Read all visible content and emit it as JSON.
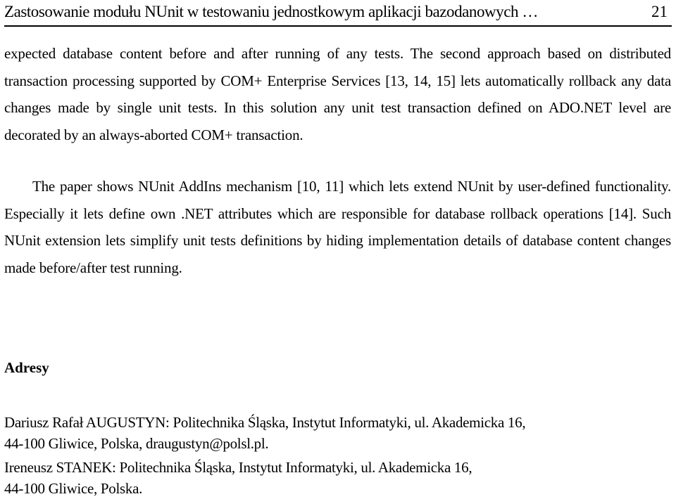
{
  "header": {
    "title": "Zastosowanie modułu NUnit w testowaniu jednostkowym aplikacji bazodanowych …",
    "page_number": "21"
  },
  "body": {
    "paragraphs": [
      "expected database content before and after running of any tests. The second approach based on distributed transaction processing supported by COM+ Enterprise Services [13, 14, 15] lets automatically rollback any data changes made by single unit tests. In this solution any unit test transaction defined on ADO.NET level are decorated by an always-aborted COM+ transaction.",
      "The paper shows NUnit AddIns mechanism [10, 11] which lets extend NUnit  by user-defined functionality. Especially it lets define own .NET attributes which are responsible for database rollback operations [14]. Such NUnit extension lets simplify unit tests definitions by hiding implementation details of database content changes made before/after test running."
    ]
  },
  "addresses": {
    "heading": "Adresy",
    "entries": [
      {
        "line1": "Dariusz Rafał AUGUSTYN: Politechnika Śląska, Instytut Informatyki, ul. Akademicka 16,",
        "line2": "44-100 Gliwice, Polska, draugustyn@polsl.pl."
      },
      {
        "line1": "Ireneusz STANEK: Politechnika Śląska, Instytut Informatyki, ul. Akademicka 16,",
        "line2": "44-100 Gliwice, Polska."
      }
    ]
  }
}
